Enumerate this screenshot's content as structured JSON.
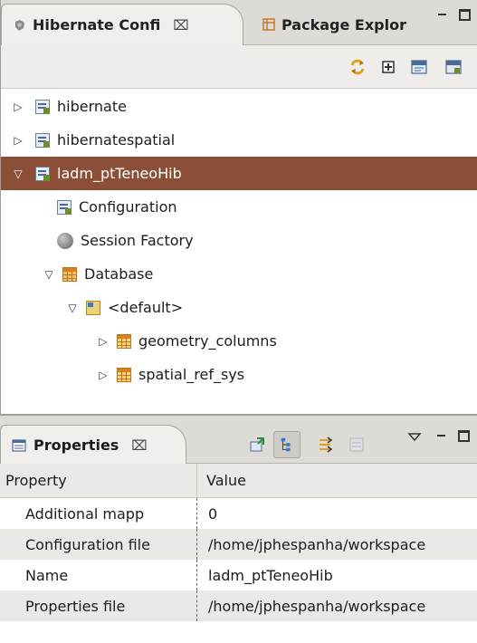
{
  "top_view": {
    "tabs": [
      {
        "label": "Hibernate Confi",
        "close": "⌧",
        "icon": "hibernate-config-icon"
      },
      {
        "label": "Package Explor",
        "icon": "package-explorer-icon"
      }
    ],
    "toolbar_icons": [
      "refresh-icon",
      "expand-icon",
      "hql-editor-icon",
      "criteria-editor-icon"
    ],
    "tree": [
      {
        "label": "hibernate",
        "twisty": "▷",
        "icon": "hibernate-config-icon"
      },
      {
        "label": "hibernatespatial",
        "twisty": "▷",
        "icon": "hibernate-config-icon"
      },
      {
        "label": "ladm_ptTeneoHib",
        "twisty": "▽",
        "icon": "hibernate-config-icon",
        "selected": true
      },
      {
        "label": "Configuration",
        "icon": "configuration-icon"
      },
      {
        "label": "Session Factory",
        "icon": "session-factory-icon"
      },
      {
        "label": "Database",
        "twisty": "▽",
        "icon": "database-icon"
      },
      {
        "label": "<default>",
        "twisty": "▽",
        "icon": "default-schema-icon"
      },
      {
        "label": "geometry_columns",
        "twisty": "▷",
        "icon": "table-icon"
      },
      {
        "label": "spatial_ref_sys",
        "twisty": "▷",
        "icon": "table-icon"
      }
    ]
  },
  "properties_view": {
    "tab": {
      "label": "Properties",
      "close": "⌧"
    },
    "toolbar_icons": [
      "pin-icon",
      "categories-icon",
      "filter-icon",
      "restore-defaults-icon",
      "view-menu-icon"
    ],
    "columns": [
      "Property",
      "Value"
    ],
    "rows": [
      {
        "property": "Additional mapp",
        "value": "0"
      },
      {
        "property": "Configuration file",
        "value": "/home/jphespanha/workspace"
      },
      {
        "property": "Name",
        "value": "ladm_ptTeneoHib"
      },
      {
        "property": "Properties file",
        "value": "/home/jphespanha/workspace"
      }
    ]
  },
  "colors": {
    "selection": "#8a4f36",
    "chrome": "#dedbd7"
  }
}
